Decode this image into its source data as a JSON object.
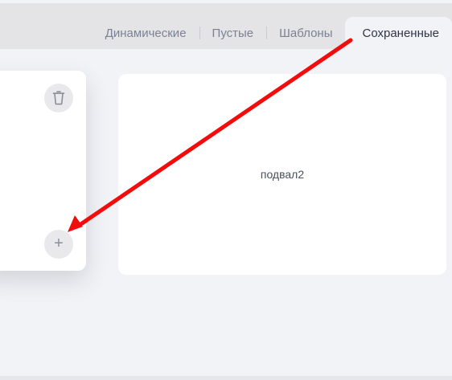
{
  "tabs": [
    {
      "label": "Динамические",
      "active": false
    },
    {
      "label": "Пустые",
      "active": false
    },
    {
      "label": "Шаблоны",
      "active": false
    },
    {
      "label": "Сохраненные",
      "active": true
    }
  ],
  "left_card": {
    "delete_icon": "trash-icon",
    "add_icon": "plus-icon",
    "add_symbol": "+"
  },
  "right_card": {
    "label": "подвал2"
  },
  "annotation": {
    "arrow_color": "#f20c0c"
  }
}
